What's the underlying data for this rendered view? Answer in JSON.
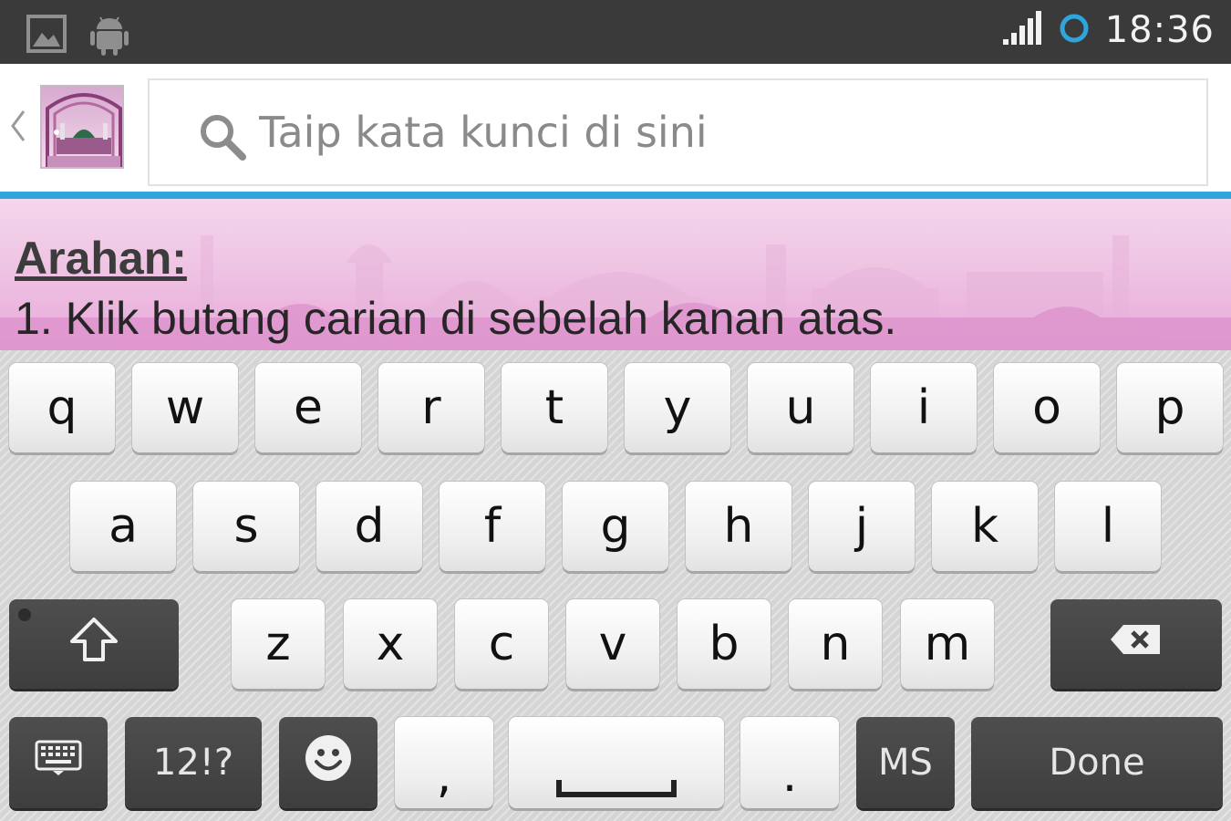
{
  "status_bar": {
    "time": "18:36",
    "icons": [
      "image-notification-icon",
      "android-notification-icon",
      "signal-strength-icon",
      "sync-ring-icon"
    ]
  },
  "action_bar": {
    "up_icon": "chevron-left-icon",
    "app_icon": "mosque-app-icon",
    "search": {
      "placeholder": "Taip kata kunci di sini",
      "value": "",
      "icon": "search-icon"
    }
  },
  "content": {
    "heading": "Arahan:",
    "instruction": "1. Klik butang carian di sebelah kanan atas."
  },
  "keyboard": {
    "row1": [
      "q",
      "w",
      "e",
      "r",
      "t",
      "y",
      "u",
      "i",
      "o",
      "p"
    ],
    "row2": [
      "a",
      "s",
      "d",
      "f",
      "g",
      "h",
      "j",
      "k",
      "l"
    ],
    "row3": [
      "z",
      "x",
      "c",
      "v",
      "b",
      "n",
      "m"
    ],
    "shift_icon": "shift-arrow-icon",
    "backspace_icon": "backspace-icon",
    "keyboard_settings_icon": "keyboard-icon",
    "symbols_label": "12!?",
    "emoji_icon": "smiley-icon",
    "comma_label": ",",
    "space_icon": "spacebar-icon",
    "period_label": ".",
    "language_label": "MS",
    "done_label": "Done"
  },
  "colors": {
    "status_bar": "#3a3a3a",
    "accent_line": "#2ea6dc",
    "content_tint": "#e8a9d9",
    "keyboard_bg": "#d5d5d5",
    "dark_key": "#444444"
  }
}
